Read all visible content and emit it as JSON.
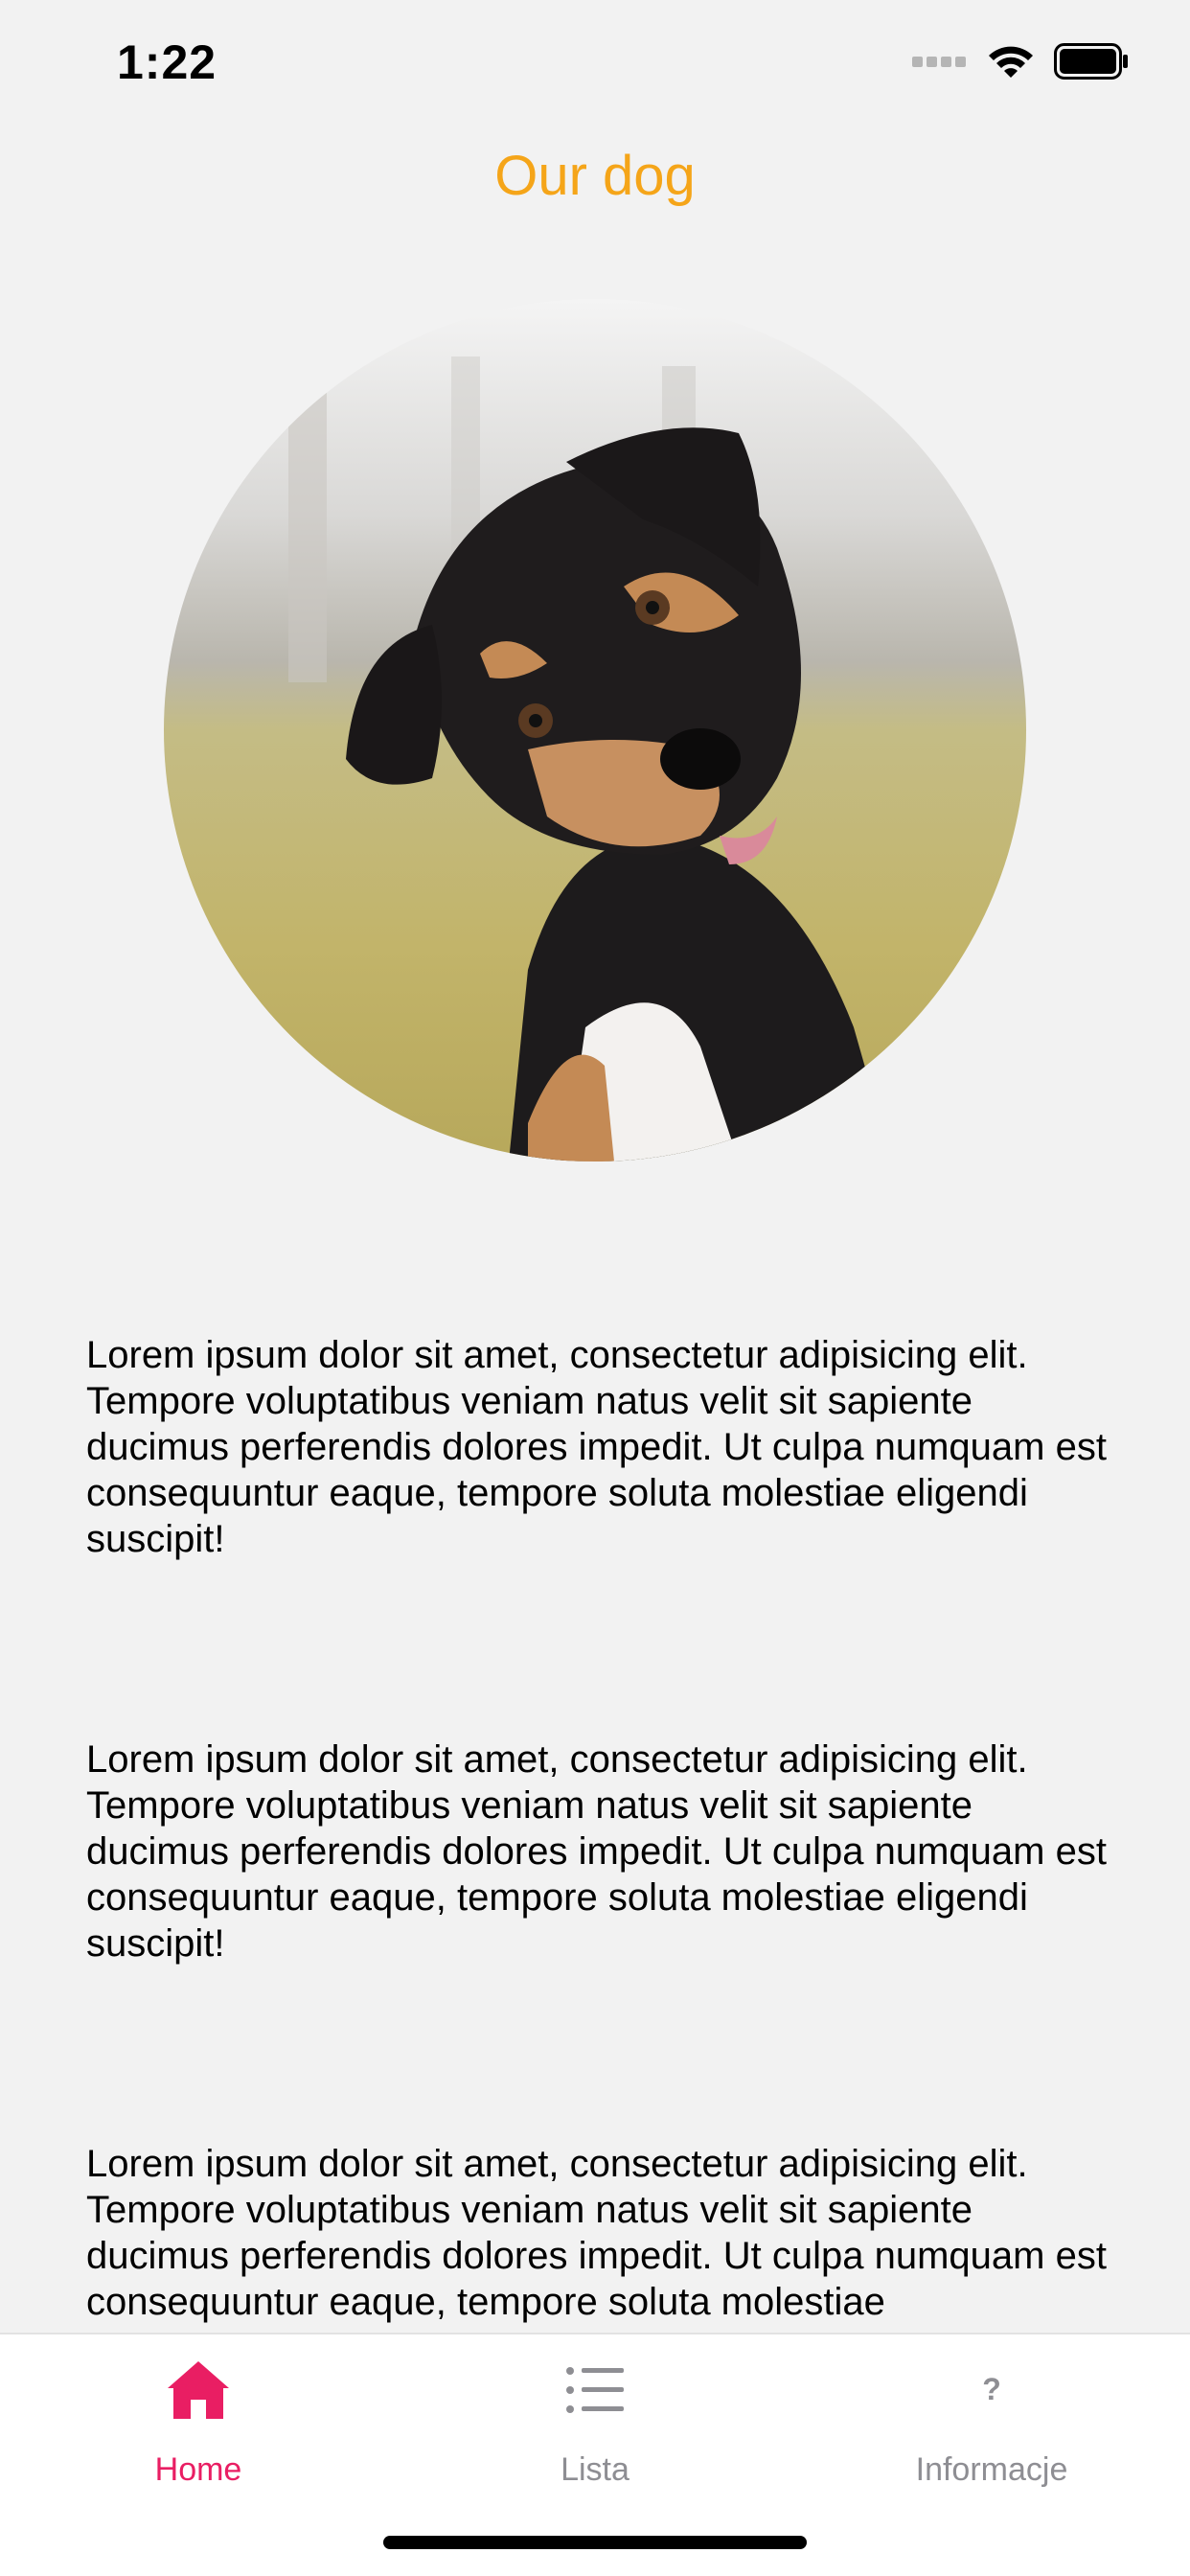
{
  "status_bar": {
    "time": "1:22"
  },
  "header": {
    "title": "Our dog",
    "title_color": "#f5a519"
  },
  "photo": {
    "icon": "dog-photo"
  },
  "paragraphs": [
    "Lorem ipsum dolor sit amet, consectetur adipisicing elit. Tempore voluptatibus veniam natus velit sit sapiente ducimus perferendis dolores impedit. Ut culpa numquam est consequuntur eaque, tempore soluta molestiae eligendi suscipit!",
    "Lorem ipsum dolor sit amet, consectetur adipisicing elit. Tempore voluptatibus veniam natus velit sit sapiente ducimus perferendis dolores impedit. Ut culpa numquam est consequuntur eaque, tempore soluta molestiae eligendi suscipit!",
    "Lorem ipsum dolor sit amet, consectetur adipisicing elit. Tempore voluptatibus veniam natus velit sit sapiente ducimus perferendis dolores impedit. Ut culpa numquam est consequuntur eaque, tempore soluta molestiae"
  ],
  "tab_bar": {
    "active_color": "#e91e63",
    "inactive_color": "#8e8e93",
    "tabs": [
      {
        "label": "Home",
        "icon": "home-icon",
        "active": true
      },
      {
        "label": "Lista",
        "icon": "list-icon",
        "active": false
      },
      {
        "label": "Informacje",
        "icon": "question-icon",
        "active": false
      }
    ]
  }
}
